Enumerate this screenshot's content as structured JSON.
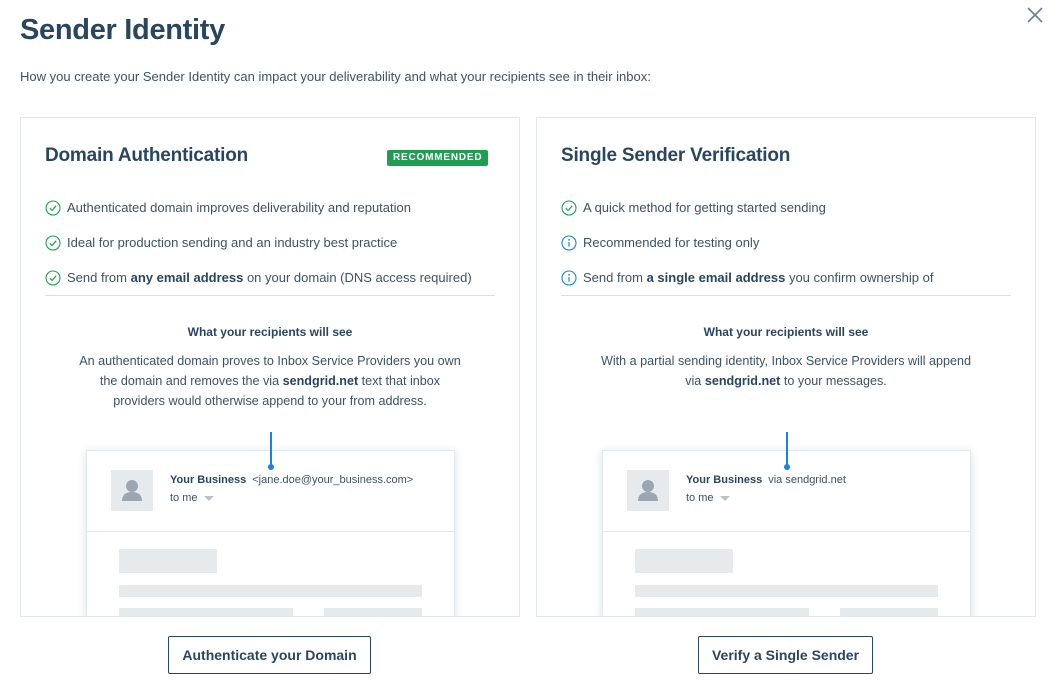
{
  "modal": {
    "title": "Sender Identity",
    "subtitle": "How you create your Sender Identity can impact your deliverability and what your recipients see in their inbox:"
  },
  "colors": {
    "primary": "#294661",
    "recommended_badge": "#1f9e52",
    "check_icon": "#1f9e52",
    "info_icon": "#1a82e2",
    "pointer": "#1a82e2"
  },
  "domain_auth": {
    "title": "Domain Authentication",
    "badge": "RECOMMENDED",
    "features": [
      {
        "icon": "check-circle-icon",
        "pre": "Authenticated domain improves deliverability and reputation",
        "bold": "",
        "post": ""
      },
      {
        "icon": "check-circle-icon",
        "pre": "Ideal for production sending and an industry best practice",
        "bold": "",
        "post": ""
      },
      {
        "icon": "check-circle-icon",
        "pre": "Send from ",
        "bold": "any email address",
        "post": " on your domain (DNS access required)"
      }
    ],
    "recipients_heading": "What your recipients will see",
    "desc_pre": "An authenticated domain proves to Inbox Service Providers you own the domain and removes the via ",
    "desc_bold": "sendgrid.net",
    "desc_post": " text that inbox providers would otherwise append to your from address.",
    "preview": {
      "business": "Your Business",
      "from": "<jane.doe@your_business.com>",
      "to": "to me"
    },
    "button": "Authenticate your Domain"
  },
  "single_sender": {
    "title": "Single Sender Verification",
    "features": [
      {
        "icon": "check-circle-icon",
        "pre": "A quick method for getting started sending",
        "bold": "",
        "post": ""
      },
      {
        "icon": "info-circle-icon",
        "pre": "Recommended for testing only",
        "bold": "",
        "post": ""
      },
      {
        "icon": "info-circle-icon",
        "pre": "Send from ",
        "bold": "a single email address",
        "post": " you confirm ownership of"
      }
    ],
    "recipients_heading": "What your recipients will see",
    "desc_pre": "With a partial sending identity, Inbox Service Providers will append via ",
    "desc_bold": "sendgrid.net",
    "desc_post": " to your messages.",
    "preview": {
      "business": "Your Business",
      "from": "via sendgrid.net",
      "to": "to me"
    },
    "button": "Verify a Single Sender"
  }
}
